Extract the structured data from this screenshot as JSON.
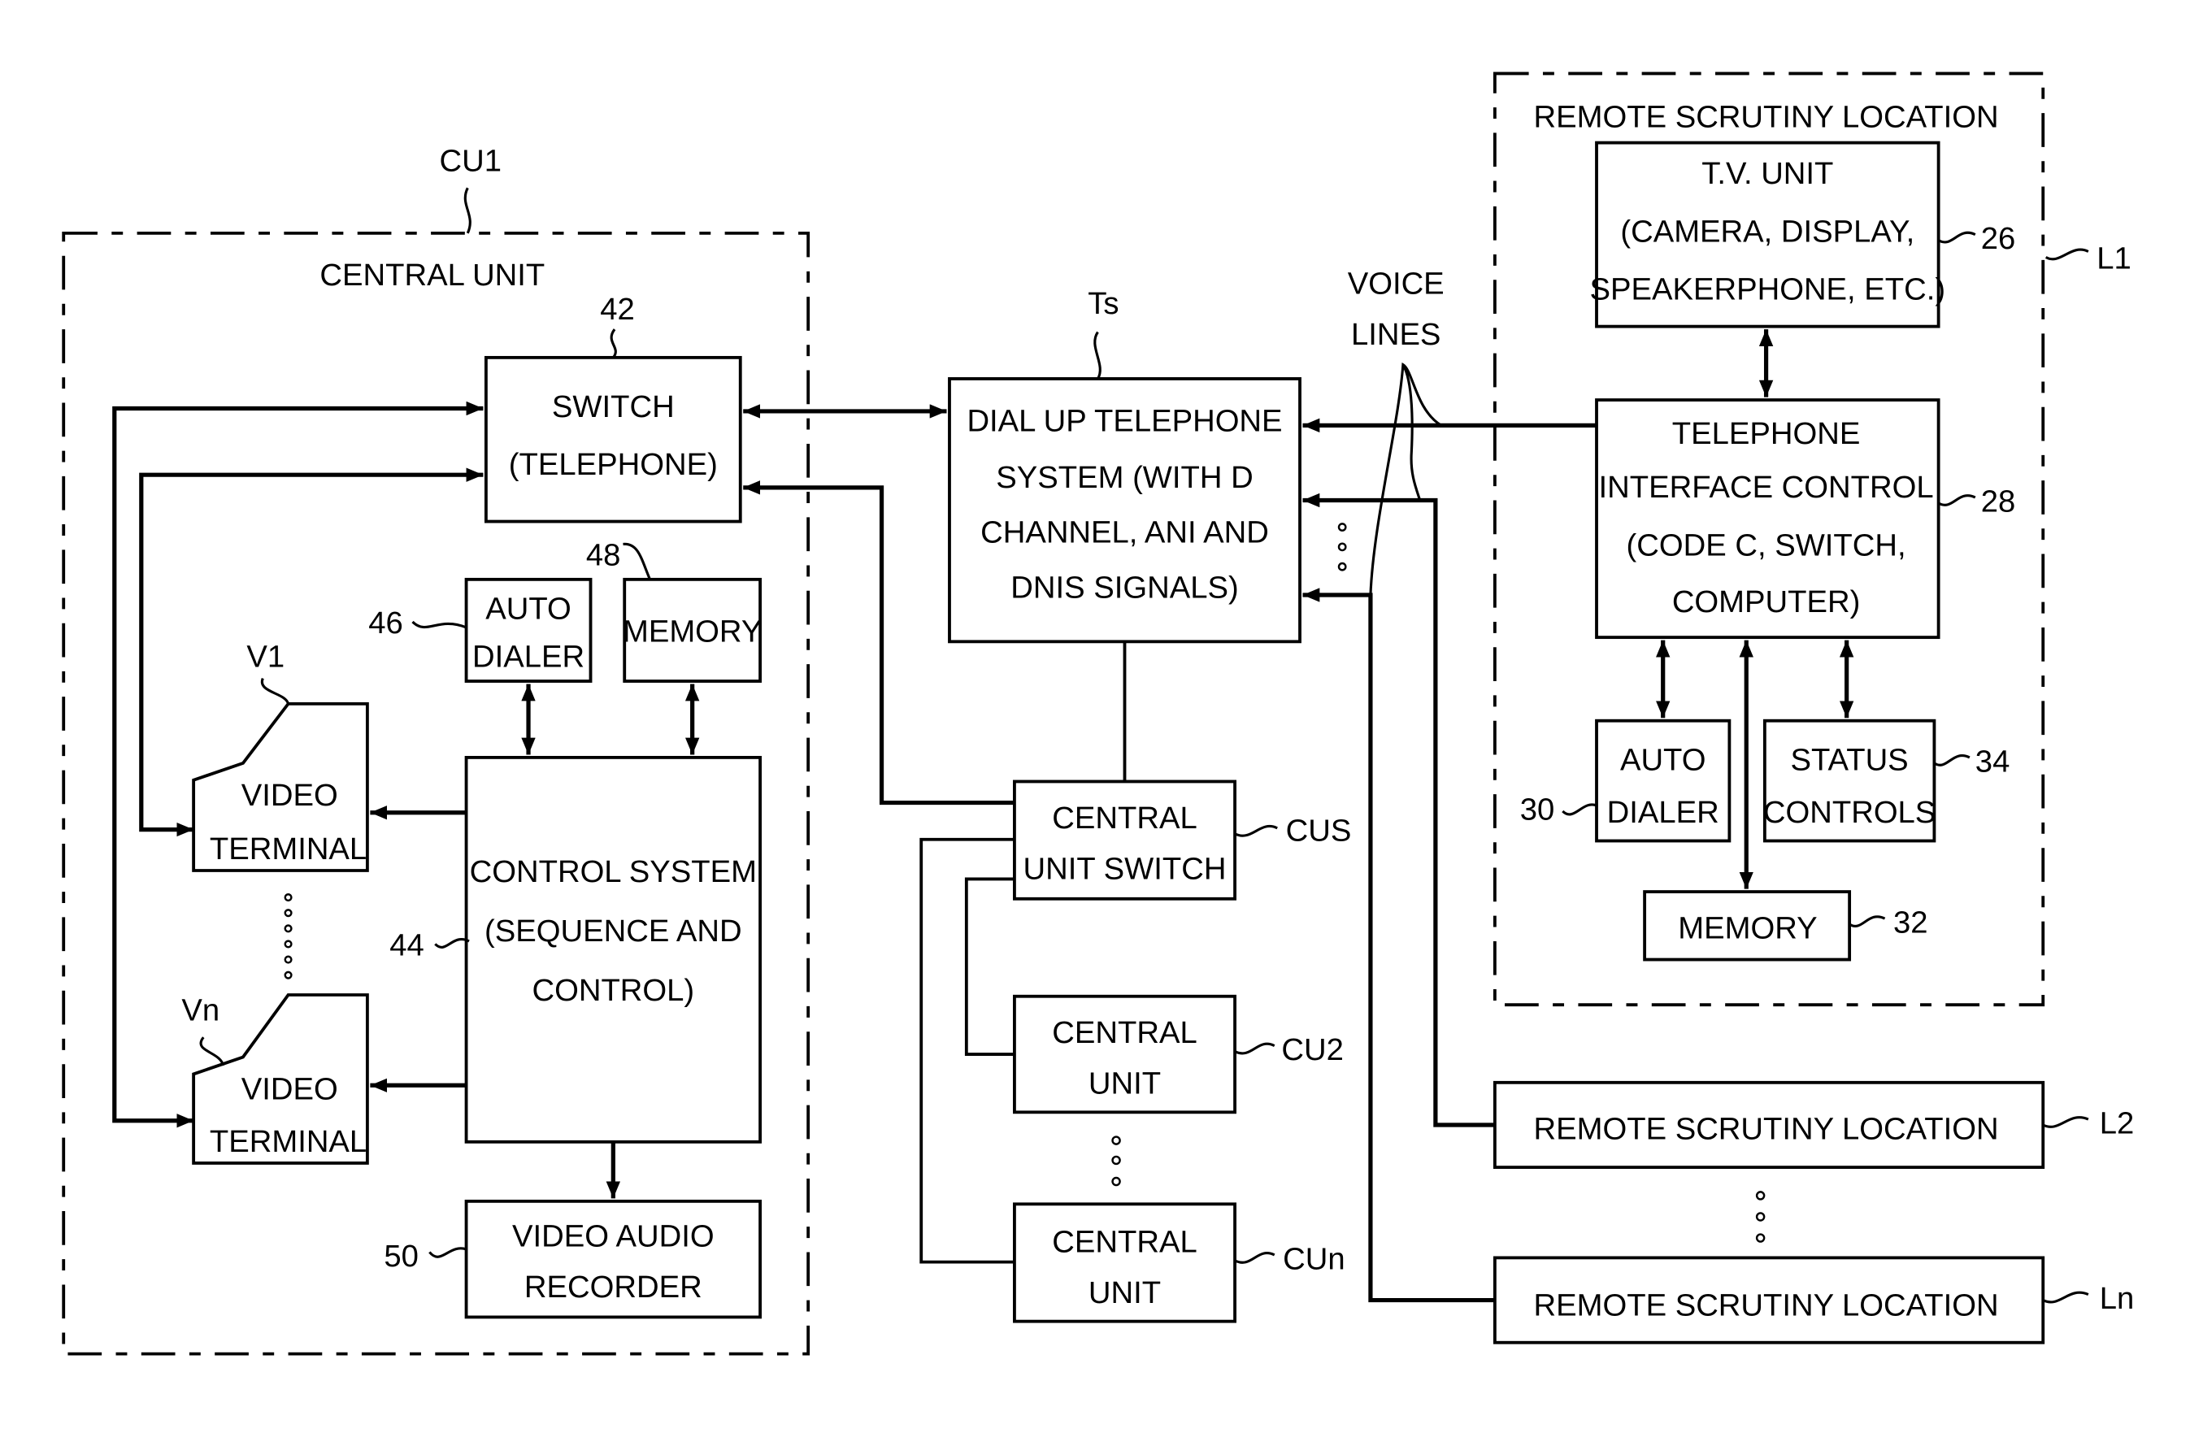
{
  "figure": {
    "central_unit": {
      "ref": "CU1",
      "title": "CENTRAL UNIT",
      "switch": {
        "ref": "42",
        "lines": [
          "SWITCH",
          "(TELEPHONE)"
        ]
      },
      "auto_dialer": {
        "ref": "46",
        "lines": [
          "AUTO",
          "DIALER"
        ]
      },
      "memory": {
        "ref": "48",
        "lines": [
          "MEMORY"
        ]
      },
      "control_system": {
        "ref": "44",
        "lines": [
          "CONTROL SYSTEM",
          "(SEQUENCE AND",
          "CONTROL)"
        ]
      },
      "video_terminal_1": {
        "ref": "V1",
        "lines": [
          "VIDEO",
          "TERMINAL"
        ]
      },
      "video_terminal_n": {
        "ref": "Vn",
        "lines": [
          "VIDEO",
          "TERMINAL"
        ]
      },
      "recorder": {
        "ref": "50",
        "lines": [
          "VIDEO AUDIO",
          "RECORDER"
        ]
      }
    },
    "telephone_system": {
      "ref": "Ts",
      "lines": [
        "DIAL UP TELEPHONE",
        "SYSTEM (WITH D",
        "CHANNEL, ANI AND",
        "DNIS SIGNALS)"
      ]
    },
    "voice_lines": {
      "lines": [
        "VOICE",
        "LINES"
      ]
    },
    "central_unit_switch": {
      "ref": "CUS",
      "lines": [
        "CENTRAL",
        "UNIT SWITCH"
      ]
    },
    "central_unit_2": {
      "ref": "CU2",
      "lines": [
        "CENTRAL",
        "UNIT"
      ]
    },
    "central_unit_n": {
      "ref": "CUn",
      "lines": [
        "CENTRAL",
        "UNIT"
      ]
    },
    "remote_location_1": {
      "ref": "L1",
      "title": "REMOTE SCRUTINY LOCATION",
      "tv_unit": {
        "ref": "26",
        "lines": [
          "T.V. UNIT",
          "(CAMERA, DISPLAY,",
          "SPEAKERPHONE, ETC.)"
        ]
      },
      "interface_control": {
        "ref": "28",
        "lines": [
          "TELEPHONE",
          "INTERFACE CONTROL",
          "(CODE C, SWITCH,",
          "COMPUTER)"
        ]
      },
      "auto_dialer": {
        "ref": "30",
        "lines": [
          "AUTO",
          "DIALER"
        ]
      },
      "status_controls": {
        "ref": "34",
        "lines": [
          "STATUS",
          "CONTROLS"
        ]
      },
      "memory": {
        "ref": "32",
        "lines": [
          "MEMORY"
        ]
      }
    },
    "remote_location_2": {
      "ref": "L2",
      "lines": [
        "REMOTE SCRUTINY LOCATION"
      ]
    },
    "remote_location_n": {
      "ref": "Ln",
      "lines": [
        "REMOTE SCRUTINY LOCATION"
      ]
    }
  }
}
